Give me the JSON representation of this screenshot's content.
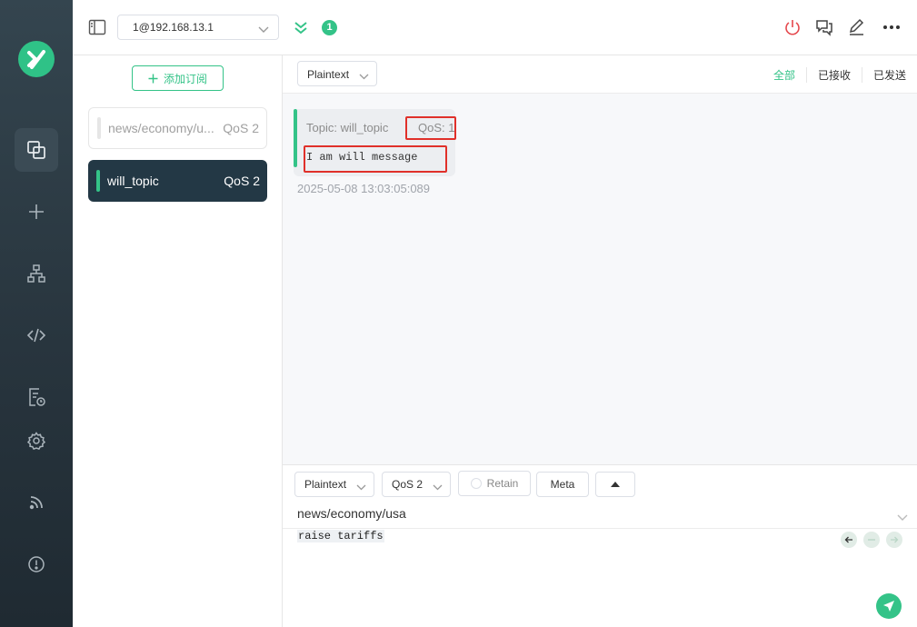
{
  "header": {
    "connection_value": "1@192.168.13.1",
    "badge_count": "1"
  },
  "subscriptions": {
    "add_label": "添加订阅",
    "items": [
      {
        "topic": "news/economy/u...",
        "qos": "QoS 2",
        "color": "#e6e6e6",
        "active": false
      },
      {
        "topic": "will_topic",
        "qos": "QoS 2",
        "color": "#34c388",
        "active": true
      }
    ]
  },
  "messages": {
    "format": "Plaintext",
    "filters": [
      "全部",
      "已接收",
      "已发送"
    ],
    "active_filter": "全部",
    "items": [
      {
        "topic_label": "Topic: will_topic",
        "qos_label": "QoS: 1",
        "payload": "I am will message",
        "time": "2025-05-08 13:03:05:089"
      }
    ]
  },
  "publish": {
    "format": "Plaintext",
    "qos": "QoS 2",
    "retain_label": "Retain",
    "meta_label": "Meta",
    "topic": "news/economy/usa",
    "payload": "raise tariffs"
  },
  "colors": {
    "accent": "#34c388",
    "rail_bg": "#2b3a44",
    "active_sub_bg": "#233845",
    "highlight_border": "#e0302a",
    "disconnect_icon": "#e5484d"
  },
  "icons": {
    "rail": [
      "mqttx-logo",
      "connections-icon",
      "plus-icon",
      "topology-icon",
      "script-icon",
      "log-icon",
      "gear-icon",
      "rss-icon",
      "info-icon"
    ],
    "header": [
      "sidebar-toggle-icon",
      "chevron-down-icon",
      "double-chevron-icon",
      "power-icon",
      "chat-icon",
      "edit-icon",
      "more-icon"
    ]
  }
}
